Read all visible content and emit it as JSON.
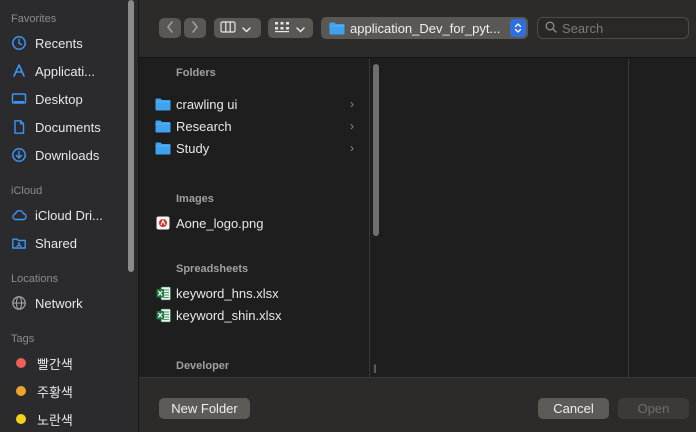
{
  "sidebar": {
    "sections": {
      "favorites": "Favorites",
      "icloud": "iCloud",
      "locations": "Locations",
      "tags": "Tags"
    },
    "favorites": [
      {
        "label": "Recents",
        "icon": "clock-icon"
      },
      {
        "label": "Applicati...",
        "icon": "applications-icon"
      },
      {
        "label": "Desktop",
        "icon": "desktop-icon"
      },
      {
        "label": "Documents",
        "icon": "document-icon"
      },
      {
        "label": "Downloads",
        "icon": "download-icon"
      }
    ],
    "icloud": [
      {
        "label": "iCloud Dri...",
        "icon": "cloud-icon"
      },
      {
        "label": "Shared",
        "icon": "shared-folder-icon"
      }
    ],
    "locations": [
      {
        "label": "Network",
        "icon": "globe-icon"
      }
    ],
    "tags": [
      {
        "label": "빨간색",
        "color": "#ec5f5a"
      },
      {
        "label": "주황색",
        "color": "#f0a22e"
      },
      {
        "label": "노란색",
        "color": "#f2d21b"
      }
    ]
  },
  "toolbar": {
    "path_label": "application_Dev_for_pyt...",
    "search_placeholder": "Search"
  },
  "groups": {
    "folders": "Folders",
    "images": "Images",
    "spreadsheets": "Spreadsheets",
    "developer": "Developer"
  },
  "files": {
    "folders": [
      "crawling ui",
      "Research",
      "Study"
    ],
    "images": [
      "Aone_logo.png"
    ],
    "spreadsheets": [
      "keyword_hns.xlsx",
      "keyword_shin.xlsx"
    ]
  },
  "footer": {
    "new_folder": "New Folder",
    "cancel": "Cancel",
    "open": "Open"
  },
  "colors": {
    "accent": "#2f6fe0",
    "folder": "#3ea2ef",
    "sidebar_icon": "#3c95f5"
  }
}
